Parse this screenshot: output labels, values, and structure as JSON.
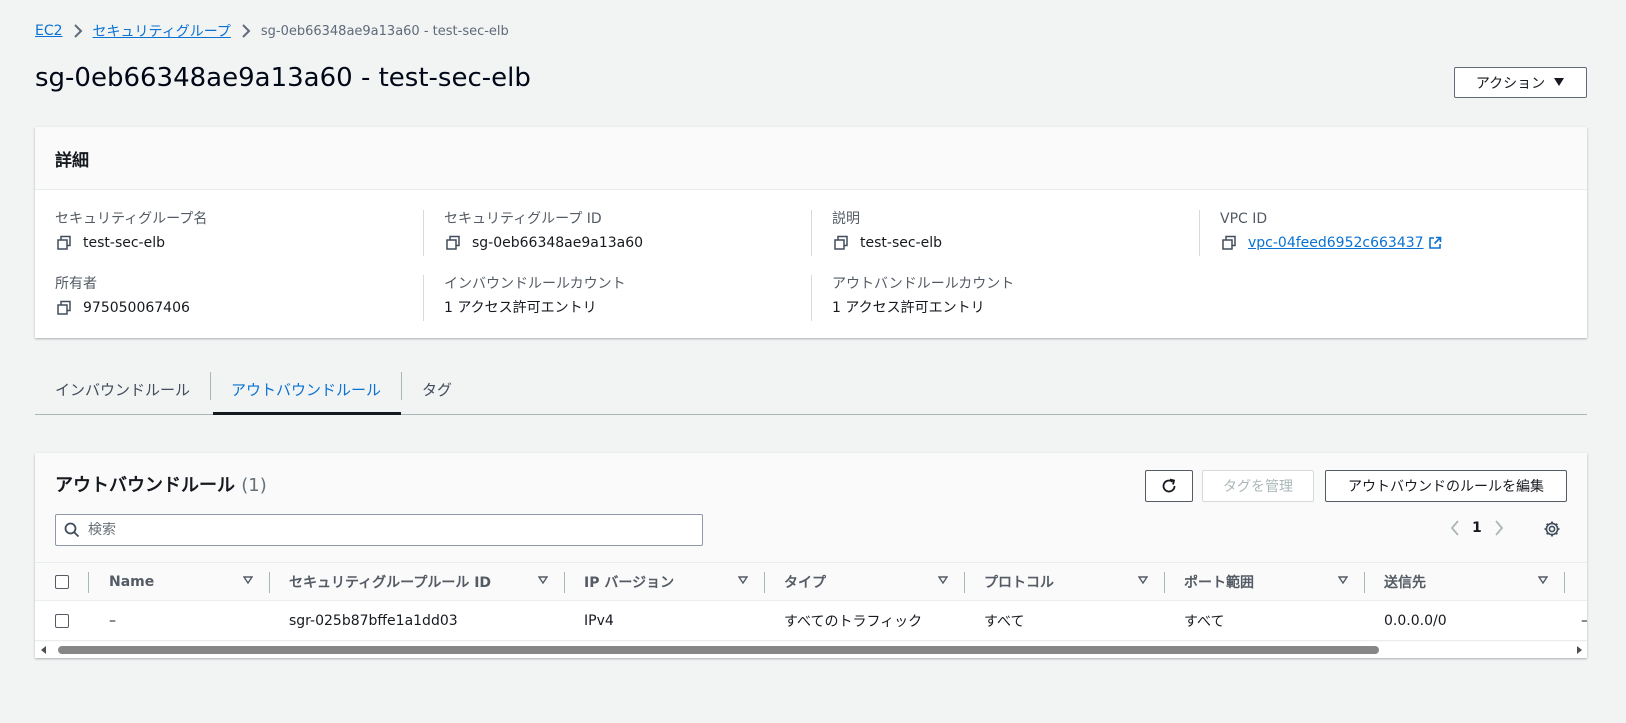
{
  "breadcrumb": {
    "items": [
      "EC2",
      "セキュリティグループ"
    ],
    "current": "sg-0eb66348ae9a13a60 - test-sec-elb"
  },
  "page": {
    "title": "sg-0eb66348ae9a13a60 - test-sec-elb",
    "action_label": "アクション"
  },
  "details": {
    "header": "詳細",
    "sg_name_label": "セキュリティグループ名",
    "sg_name_value": "test-sec-elb",
    "sg_id_label": "セキュリティグループ ID",
    "sg_id_value": "sg-0eb66348ae9a13a60",
    "desc_label": "説明",
    "desc_value": "test-sec-elb",
    "vpc_label": "VPC ID",
    "vpc_value": "vpc-04feed6952c663437",
    "owner_label": "所有者",
    "owner_value": "975050067406",
    "inbound_count_label": "インバウンドルールカウント",
    "inbound_count_value": "1 アクセス許可エントリ",
    "outbound_count_label": "アウトバンドルールカウント",
    "outbound_count_value": "1 アクセス許可エントリ"
  },
  "tabs": [
    {
      "label": "インバウンドルール",
      "active": false
    },
    {
      "label": "アウトバウンドルール",
      "active": true
    },
    {
      "label": "タグ",
      "active": false
    }
  ],
  "rules": {
    "title": "アウトバウンドルール",
    "count": "(1)",
    "manage_tags_label": "タグを管理",
    "edit_label": "アウトバウンドのルールを編集",
    "search_placeholder": "検索",
    "page_number": "1",
    "columns": [
      "Name",
      "セキュリティグループルール ID",
      "IP バージョン",
      "タイプ",
      "プロトコル",
      "ポート範囲",
      "送信先"
    ],
    "rows": [
      {
        "name": "–",
        "rule_id": "sgr-025b87bffe1a1dd03",
        "ip_version": "IPv4",
        "type": "すべてのトラフィック",
        "protocol": "すべて",
        "port_range": "すべて",
        "destination": "0.0.0.0/0",
        "extra": "–"
      }
    ]
  },
  "colors": {
    "link": "#0972d3",
    "background": "#f2f3f3",
    "active_tab": "#0972d3"
  }
}
